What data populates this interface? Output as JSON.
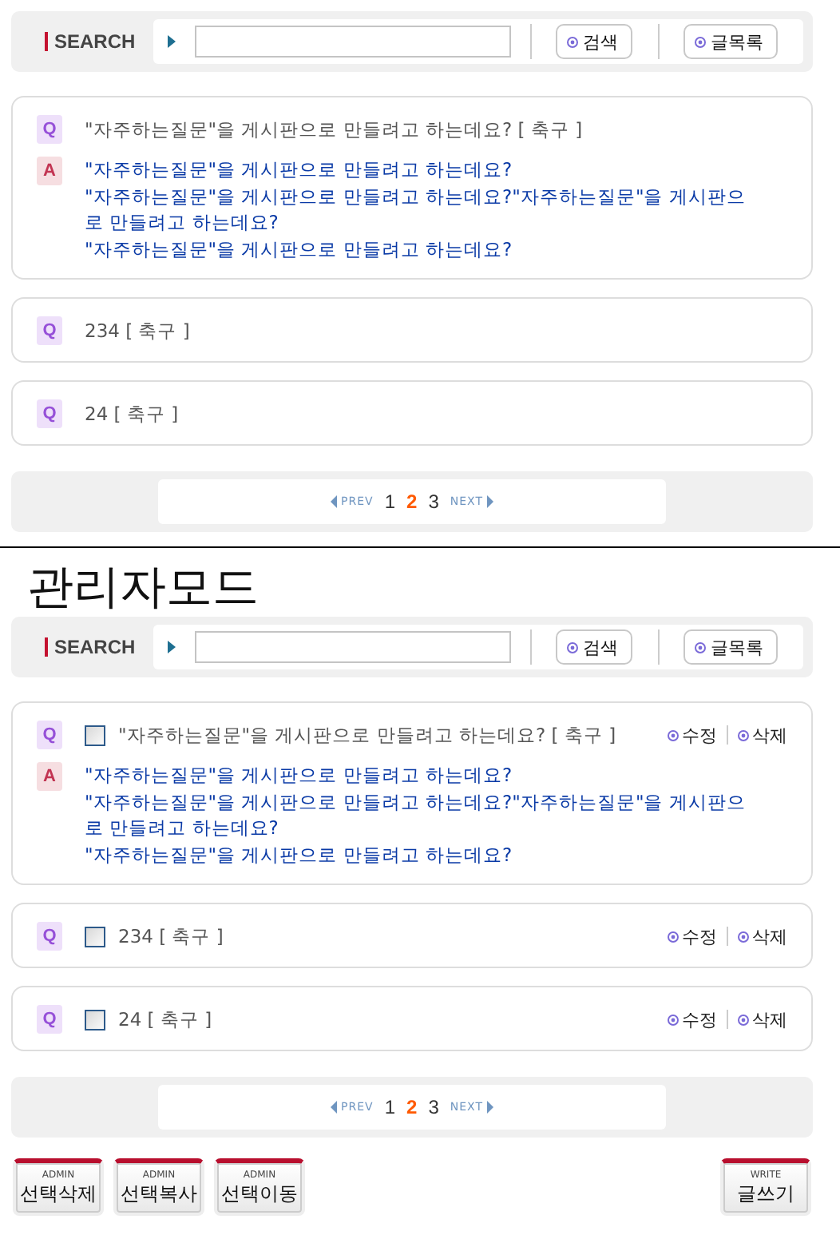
{
  "user_view": {
    "search": {
      "label": "SEARCH",
      "buttons": [
        "검색",
        "글목록"
      ]
    },
    "faqs": [
      {
        "question": "\"자주하는질문\"을 게시판으로 만들려고 하는데요? [ 축구 ]",
        "expanded": true,
        "q_mark": "Q",
        "a_mark": "A",
        "answer_lines": [
          "\"자주하는질문\"을 게시판으로 만들려고 하는데요?",
          "\"자주하는질문\"을 게시판으로 만들려고 하는데요?\"자주하는질문\"을 게시판으",
          "로 만들려고 하는데요?",
          "\"자주하는질문\"을 게시판으로 만들려고 하는데요?"
        ]
      },
      {
        "question": "234 [ 축구 ]",
        "expanded": false,
        "q_mark": "Q"
      },
      {
        "question": "24 [ 축구 ]",
        "expanded": false,
        "q_mark": "Q"
      }
    ],
    "pagination": {
      "prev": "PREV",
      "next": "NEXT",
      "pages": [
        {
          "label": "1",
          "selected": false
        },
        {
          "label": "2",
          "selected": true
        },
        {
          "label": "3",
          "selected": false
        }
      ]
    }
  },
  "admin_title": "관리자모드",
  "admin_view": {
    "search": {
      "label": "SEARCH",
      "buttons": [
        "검색",
        "글목록"
      ]
    },
    "faqs": [
      {
        "question": "\"자주하는질문\"을 게시판으로 만들려고 하는데요? [ 축구 ]",
        "checked": false,
        "expanded": true,
        "q_mark": "Q",
        "a_mark": "A",
        "edit": "수정",
        "delete": "삭제",
        "answer_lines": [
          "\"자주하는질문\"을 게시판으로 만들려고 하는데요?",
          "\"자주하는질문\"을 게시판으로 만들려고 하는데요?\"자주하는질문\"을 게시판으",
          "로 만들려고 하는데요?",
          "\"자주하는질문\"을 게시판으로 만들려고 하는데요?"
        ]
      },
      {
        "question": "234 [ 축구 ]",
        "checked": false,
        "expanded": false,
        "q_mark": "Q",
        "edit": "수정",
        "delete": "삭제"
      },
      {
        "question": "24 [ 축구 ]",
        "checked": false,
        "expanded": false,
        "q_mark": "Q",
        "edit": "수정",
        "delete": "삭제"
      }
    ],
    "pagination": {
      "prev": "PREV",
      "next": "NEXT",
      "pages": [
        {
          "label": "1",
          "selected": false
        },
        {
          "label": "2",
          "selected": true
        },
        {
          "label": "3",
          "selected": false
        }
      ]
    },
    "left_buttons": [
      {
        "tag": "ADMIN",
        "label": "선택삭제"
      },
      {
        "tag": "ADMIN",
        "label": "선택복사"
      },
      {
        "tag": "ADMIN",
        "label": "선택이동"
      }
    ],
    "right_buttons": [
      {
        "tag": "WRITE",
        "label": "글쓰기"
      }
    ]
  }
}
